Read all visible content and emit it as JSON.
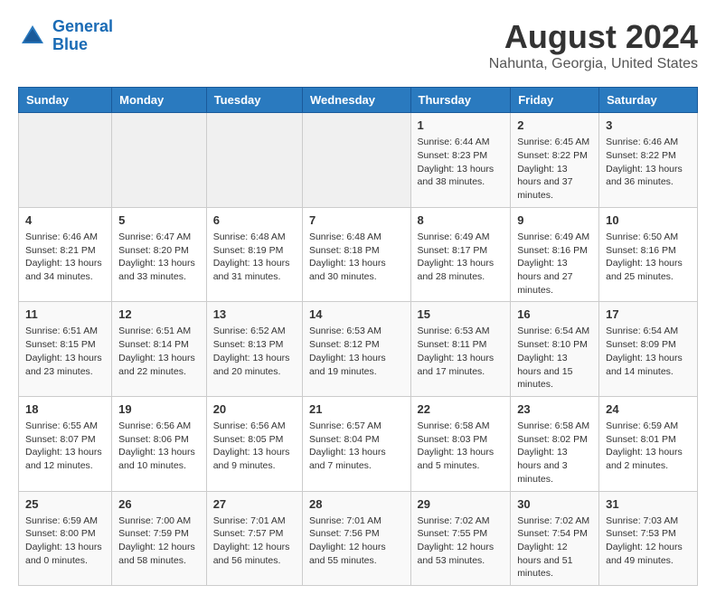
{
  "logo": {
    "line1": "General",
    "line2": "Blue"
  },
  "title": "August 2024",
  "subtitle": "Nahunta, Georgia, United States",
  "days_of_week": [
    "Sunday",
    "Monday",
    "Tuesday",
    "Wednesday",
    "Thursday",
    "Friday",
    "Saturday"
  ],
  "weeks": [
    [
      {
        "day": "",
        "info": ""
      },
      {
        "day": "",
        "info": ""
      },
      {
        "day": "",
        "info": ""
      },
      {
        "day": "",
        "info": ""
      },
      {
        "day": "1",
        "info": "Sunrise: 6:44 AM\nSunset: 8:23 PM\nDaylight: 13 hours and 38 minutes."
      },
      {
        "day": "2",
        "info": "Sunrise: 6:45 AM\nSunset: 8:22 PM\nDaylight: 13 hours and 37 minutes."
      },
      {
        "day": "3",
        "info": "Sunrise: 6:46 AM\nSunset: 8:22 PM\nDaylight: 13 hours and 36 minutes."
      }
    ],
    [
      {
        "day": "4",
        "info": "Sunrise: 6:46 AM\nSunset: 8:21 PM\nDaylight: 13 hours and 34 minutes."
      },
      {
        "day": "5",
        "info": "Sunrise: 6:47 AM\nSunset: 8:20 PM\nDaylight: 13 hours and 33 minutes."
      },
      {
        "day": "6",
        "info": "Sunrise: 6:48 AM\nSunset: 8:19 PM\nDaylight: 13 hours and 31 minutes."
      },
      {
        "day": "7",
        "info": "Sunrise: 6:48 AM\nSunset: 8:18 PM\nDaylight: 13 hours and 30 minutes."
      },
      {
        "day": "8",
        "info": "Sunrise: 6:49 AM\nSunset: 8:17 PM\nDaylight: 13 hours and 28 minutes."
      },
      {
        "day": "9",
        "info": "Sunrise: 6:49 AM\nSunset: 8:16 PM\nDaylight: 13 hours and 27 minutes."
      },
      {
        "day": "10",
        "info": "Sunrise: 6:50 AM\nSunset: 8:16 PM\nDaylight: 13 hours and 25 minutes."
      }
    ],
    [
      {
        "day": "11",
        "info": "Sunrise: 6:51 AM\nSunset: 8:15 PM\nDaylight: 13 hours and 23 minutes."
      },
      {
        "day": "12",
        "info": "Sunrise: 6:51 AM\nSunset: 8:14 PM\nDaylight: 13 hours and 22 minutes."
      },
      {
        "day": "13",
        "info": "Sunrise: 6:52 AM\nSunset: 8:13 PM\nDaylight: 13 hours and 20 minutes."
      },
      {
        "day": "14",
        "info": "Sunrise: 6:53 AM\nSunset: 8:12 PM\nDaylight: 13 hours and 19 minutes."
      },
      {
        "day": "15",
        "info": "Sunrise: 6:53 AM\nSunset: 8:11 PM\nDaylight: 13 hours and 17 minutes."
      },
      {
        "day": "16",
        "info": "Sunrise: 6:54 AM\nSunset: 8:10 PM\nDaylight: 13 hours and 15 minutes."
      },
      {
        "day": "17",
        "info": "Sunrise: 6:54 AM\nSunset: 8:09 PM\nDaylight: 13 hours and 14 minutes."
      }
    ],
    [
      {
        "day": "18",
        "info": "Sunrise: 6:55 AM\nSunset: 8:07 PM\nDaylight: 13 hours and 12 minutes."
      },
      {
        "day": "19",
        "info": "Sunrise: 6:56 AM\nSunset: 8:06 PM\nDaylight: 13 hours and 10 minutes."
      },
      {
        "day": "20",
        "info": "Sunrise: 6:56 AM\nSunset: 8:05 PM\nDaylight: 13 hours and 9 minutes."
      },
      {
        "day": "21",
        "info": "Sunrise: 6:57 AM\nSunset: 8:04 PM\nDaylight: 13 hours and 7 minutes."
      },
      {
        "day": "22",
        "info": "Sunrise: 6:58 AM\nSunset: 8:03 PM\nDaylight: 13 hours and 5 minutes."
      },
      {
        "day": "23",
        "info": "Sunrise: 6:58 AM\nSunset: 8:02 PM\nDaylight: 13 hours and 3 minutes."
      },
      {
        "day": "24",
        "info": "Sunrise: 6:59 AM\nSunset: 8:01 PM\nDaylight: 13 hours and 2 minutes."
      }
    ],
    [
      {
        "day": "25",
        "info": "Sunrise: 6:59 AM\nSunset: 8:00 PM\nDaylight: 13 hours and 0 minutes."
      },
      {
        "day": "26",
        "info": "Sunrise: 7:00 AM\nSunset: 7:59 PM\nDaylight: 12 hours and 58 minutes."
      },
      {
        "day": "27",
        "info": "Sunrise: 7:01 AM\nSunset: 7:57 PM\nDaylight: 12 hours and 56 minutes."
      },
      {
        "day": "28",
        "info": "Sunrise: 7:01 AM\nSunset: 7:56 PM\nDaylight: 12 hours and 55 minutes."
      },
      {
        "day": "29",
        "info": "Sunrise: 7:02 AM\nSunset: 7:55 PM\nDaylight: 12 hours and 53 minutes."
      },
      {
        "day": "30",
        "info": "Sunrise: 7:02 AM\nSunset: 7:54 PM\nDaylight: 12 hours and 51 minutes."
      },
      {
        "day": "31",
        "info": "Sunrise: 7:03 AM\nSunset: 7:53 PM\nDaylight: 12 hours and 49 minutes."
      }
    ]
  ]
}
